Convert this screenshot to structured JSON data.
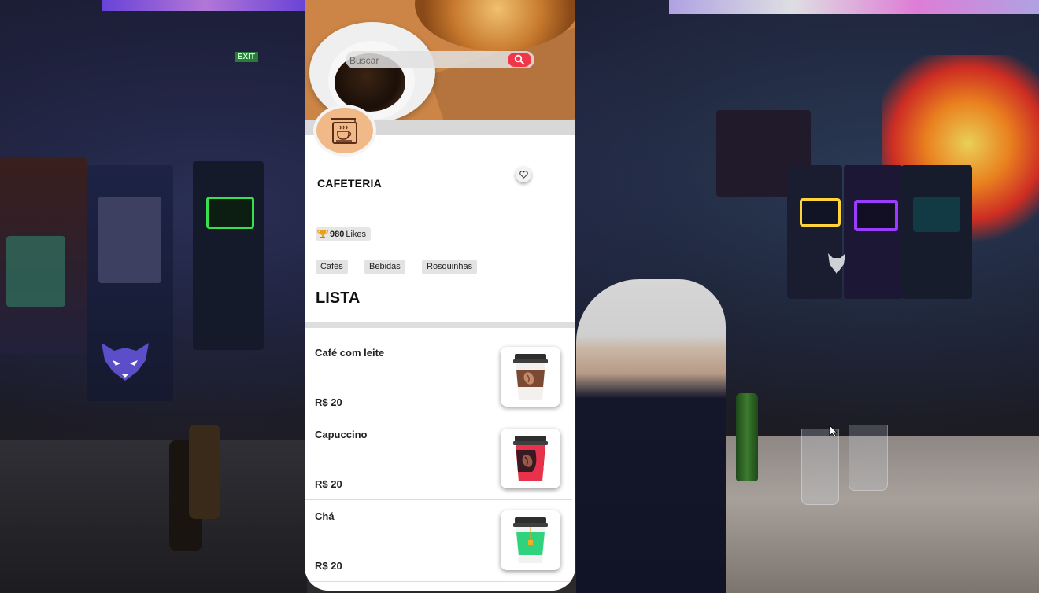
{
  "app": {
    "search": {
      "placeholder": "Buscar",
      "value": ""
    },
    "store_name": "CAFETERIA",
    "likes": {
      "count": "980",
      "label": "Likes"
    },
    "categories": [
      "Cafés",
      "Bebidas",
      "Rosquinhas"
    ],
    "list_title": "LISTA",
    "items": [
      {
        "name": "Café com leite",
        "price": "R$ 20",
        "icon": "coffee-cup-brown-icon",
        "accent": "#7b4a34"
      },
      {
        "name": "Capuccino",
        "price": "R$ 20",
        "icon": "coffee-cup-red-icon",
        "accent": "#e8314a"
      },
      {
        "name": "Chá",
        "price": "R$ 20",
        "icon": "tea-cup-green-icon",
        "accent": "#2fd37e"
      }
    ],
    "colors": {
      "accent_red": "#f0374a",
      "banner": "#cc8546",
      "logo_bg": "#f0b987",
      "trophy": "#e8a21a"
    }
  },
  "scene": {
    "exit_sign": "EXIT"
  }
}
